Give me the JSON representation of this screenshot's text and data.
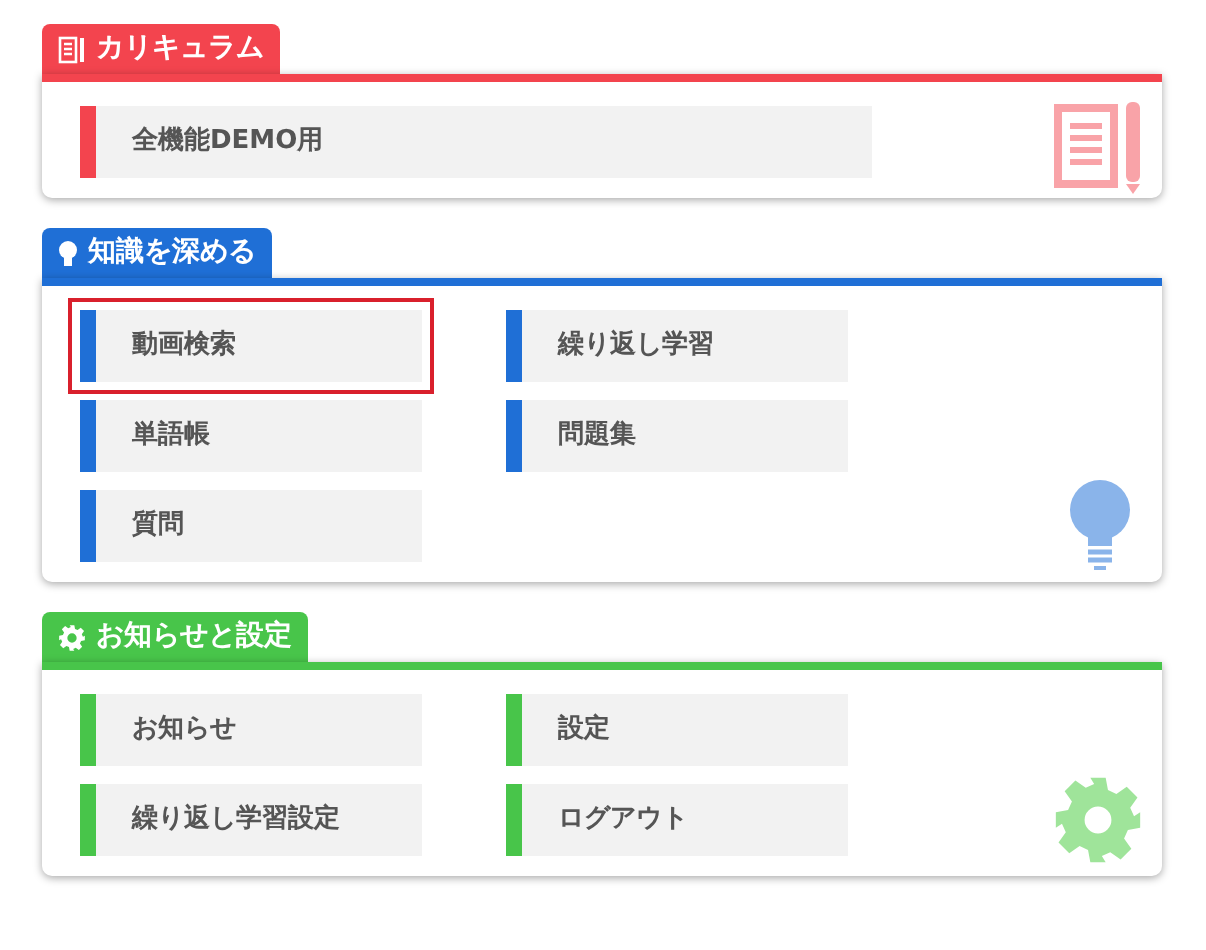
{
  "sections": [
    {
      "title": "カリキュラム",
      "kind": "curriculum",
      "color": "#f3444e",
      "items": [
        {
          "label": "全機能DEMO用",
          "selected": false
        }
      ]
    },
    {
      "title": "知識を深める",
      "kind": "knowledge",
      "color": "#1f6fd6",
      "items": [
        {
          "label": "動画検索",
          "selected": true
        },
        {
          "label": "繰り返し学習",
          "selected": false
        },
        {
          "label": "単語帳",
          "selected": false
        },
        {
          "label": "問題集",
          "selected": false
        },
        {
          "label": "質問",
          "selected": false
        }
      ]
    },
    {
      "title": "お知らせと設定",
      "kind": "settings",
      "color": "#48c54a",
      "items": [
        {
          "label": "お知らせ",
          "selected": false
        },
        {
          "label": "設定",
          "selected": false
        },
        {
          "label": "繰り返し学習設定",
          "selected": false
        },
        {
          "label": "ログアウト",
          "selected": false
        }
      ]
    }
  ]
}
